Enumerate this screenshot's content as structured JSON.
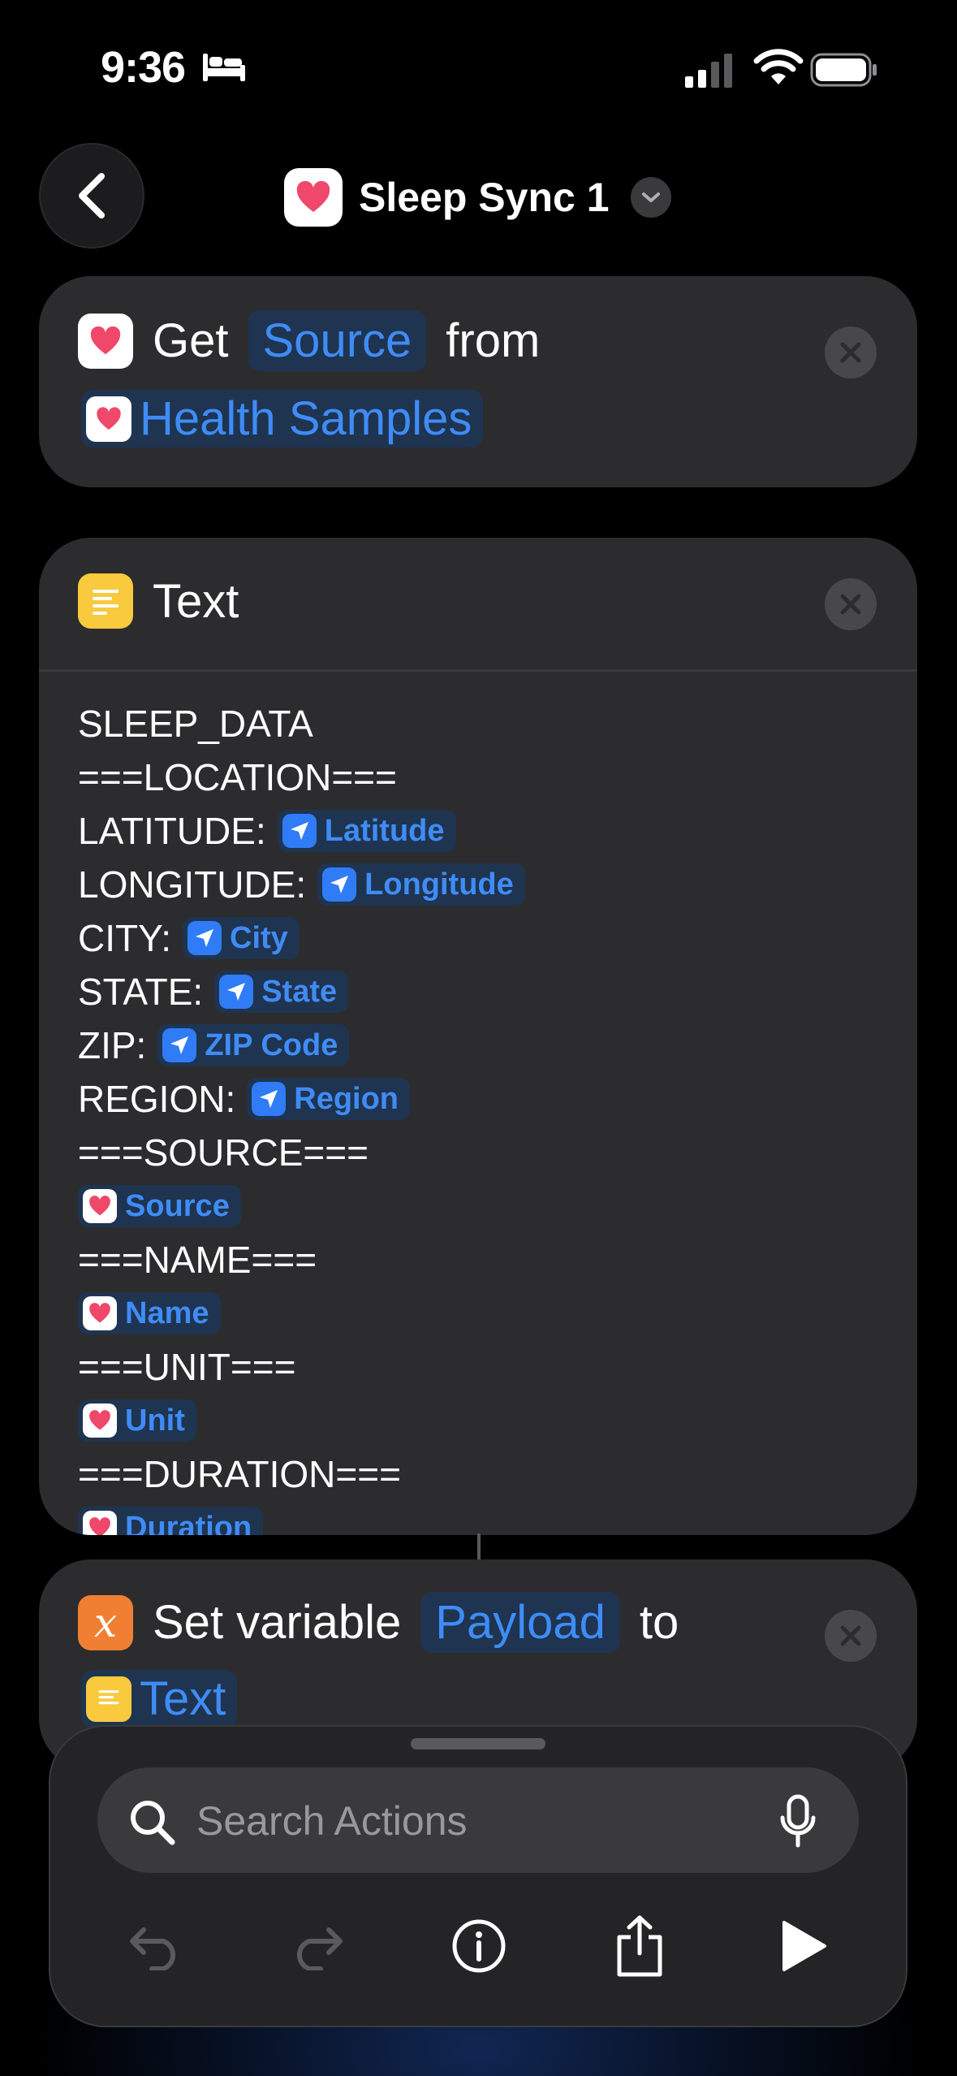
{
  "status_bar": {
    "time": "9:36"
  },
  "nav": {
    "title": "Sleep Sync 1"
  },
  "action_get": {
    "verb": "Get",
    "param": "Source",
    "preposition": "from",
    "input": "Health Samples"
  },
  "action_text": {
    "title": "Text",
    "lines": {
      "l1": "SLEEP_DATA",
      "l2": "===LOCATION===",
      "latitude_label": "LATITUDE:",
      "latitude_var": "Latitude",
      "longitude_label": "LONGITUDE:",
      "longitude_var": "Longitude",
      "city_label": "CITY:",
      "city_var": "City",
      "state_label": "STATE:",
      "state_var": "State",
      "zip_label": "ZIP:",
      "zip_var": "ZIP Code",
      "region_label": "REGION:",
      "region_var": "Region",
      "source_hdr": "===SOURCE===",
      "source_var": "Source",
      "name_hdr": "===NAME===",
      "name_var": "Name",
      "unit_hdr": "===UNIT===",
      "unit_var": "Unit",
      "duration_hdr": "===DURATION===",
      "duration_var": "Duration"
    }
  },
  "action_set": {
    "verb": "Set variable",
    "var": "Payload",
    "preposition": "to",
    "input": "Text"
  },
  "search": {
    "placeholder": "Search Actions"
  },
  "colors": {
    "accent": "#3f8cf7",
    "card": "#2c2c2e",
    "background": "#000000",
    "heart": "#f0486a",
    "text_icon": "#f9c93e",
    "variable_icon": "#f07f33"
  },
  "icons": [
    "bed-icon",
    "cellular-signal-icon",
    "wifi-icon",
    "battery-icon",
    "chevron-left-icon",
    "heart-icon",
    "location-arrow-icon",
    "text-lines-icon",
    "variable-x-icon",
    "close-icon",
    "search-icon",
    "microphone-icon",
    "undo-icon",
    "redo-icon",
    "info-icon",
    "share-icon",
    "play-icon"
  ]
}
